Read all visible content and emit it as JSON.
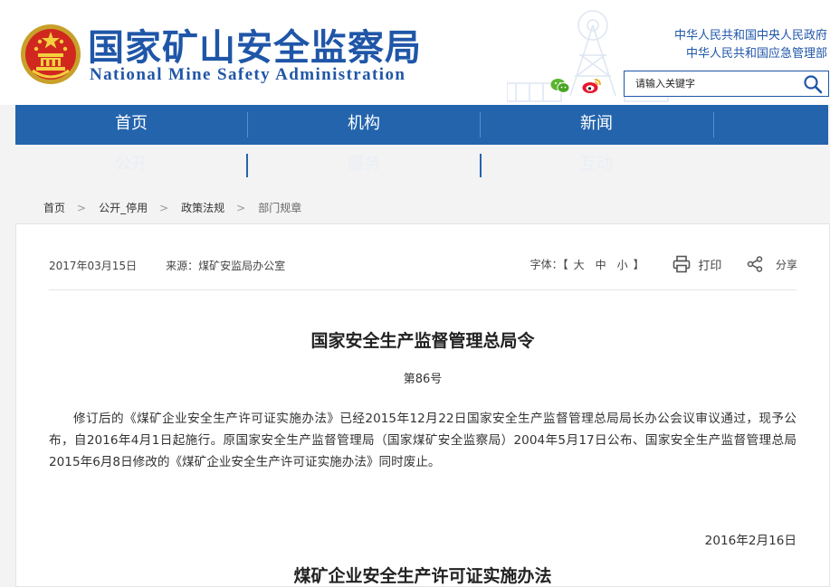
{
  "header": {
    "title_cn": "国家矿山安全监察局",
    "title_en": "National Mine Safety Administration",
    "gov_links": [
      "中华人民共和国中央人民政府",
      "中华人民共和国应急管理部"
    ],
    "search": {
      "placeholder": "请输入关键字",
      "value": ""
    },
    "icons": [
      "national-emblem",
      "wechat-icon",
      "weibo-icon",
      "search-icon"
    ]
  },
  "nav": {
    "primary": [
      "首页",
      "机构",
      "新闻"
    ],
    "secondary": [
      "公开",
      "服务",
      "互动"
    ]
  },
  "breadcrumb": [
    "首页",
    "公开_停用",
    "政策法规",
    "部门规章"
  ],
  "article": {
    "date": "2017年03月15日",
    "source": "来源：煤矿安监局办公室",
    "font_size_label": "字体：【",
    "font_sizes": [
      "大",
      "中",
      "小"
    ],
    "font_size_close": "】",
    "print_label": "打印",
    "share_label": "分享",
    "title": "国家安全生产监督管理总局令",
    "number": "第86号",
    "body": "修订后的《煤矿企业安全生产许可证实施办法》已经2015年12月22日国家安全生产监督管理总局局长办公会议审议通过，现予公布，自2016年4月1日起施行。原国家安全生产监督管理局（国家煤矿安全监察局）2004年5月17日公布、国家安全生产监督管理总局2015年6月8日修改的《煤矿企业安全生产许可证实施办法》同时废止。",
    "signed_date": "2016年2月16日",
    "subtitle": "煤矿企业安全生产许可证实施办法"
  },
  "colors": {
    "brand_blue": "#1f56a8",
    "nav_blue": "#2364ad",
    "page_bg": "#f3f3f3"
  }
}
